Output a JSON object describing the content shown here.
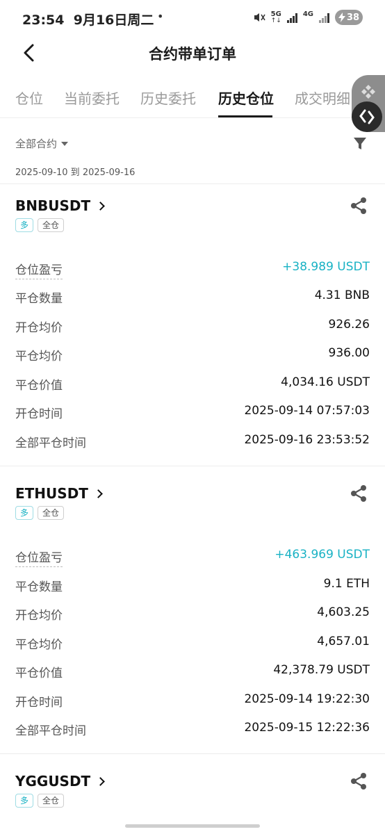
{
  "status_bar": {
    "time": "23:54",
    "date": "9月16日周二",
    "dot": "•",
    "net_5g": "5G",
    "net_4g": "4G",
    "battery": "38"
  },
  "nav": {
    "title": "合约带单订单",
    "back_icon": "chevron-left-icon"
  },
  "tabs": [
    {
      "label": "仓位",
      "active": false
    },
    {
      "label": "当前委托",
      "active": false
    },
    {
      "label": "历史委托",
      "active": false
    },
    {
      "label": "历史仓位",
      "active": true
    },
    {
      "label": "成交明细",
      "active": false
    }
  ],
  "filter": {
    "contract_label": "全部合约",
    "filter_icon": "funnel-icon",
    "date_range": "2025-09-10  到  2025-09-16"
  },
  "positions": [
    {
      "symbol": "BNBUSDT",
      "side_tag": "多",
      "margin_tag": "全仓",
      "rows": [
        {
          "label": "仓位盈亏",
          "value": "+38.989 USDT"
        },
        {
          "label": "平仓数量",
          "value": "4.31 BNB"
        },
        {
          "label": "开仓均价",
          "value": "926.26"
        },
        {
          "label": "平仓均价",
          "value": "936.00"
        },
        {
          "label": "平仓价值",
          "value": "4,034.16 USDT"
        },
        {
          "label": "开仓时间",
          "value": "2025-09-14 07:57:03"
        },
        {
          "label": "全部平仓时间",
          "value": "2025-09-16 23:53:52"
        }
      ]
    },
    {
      "symbol": "ETHUSDT",
      "side_tag": "多",
      "margin_tag": "全仓",
      "rows": [
        {
          "label": "仓位盈亏",
          "value": "+463.969 USDT"
        },
        {
          "label": "平仓数量",
          "value": "9.1 ETH"
        },
        {
          "label": "开仓均价",
          "value": "4,603.25"
        },
        {
          "label": "平仓均价",
          "value": "4,657.01"
        },
        {
          "label": "平仓价值",
          "value": "42,378.79 USDT"
        },
        {
          "label": "开仓时间",
          "value": "2025-09-14 19:22:30"
        },
        {
          "label": "全部平仓时间",
          "value": "2025-09-15 12:22:36"
        }
      ]
    },
    {
      "symbol": "YGGUSDT",
      "side_tag": "多",
      "margin_tag": "全仓"
    }
  ],
  "colors": {
    "profit": "#19b2c4",
    "text_primary": "#1a1a1a",
    "text_secondary": "#555555"
  }
}
